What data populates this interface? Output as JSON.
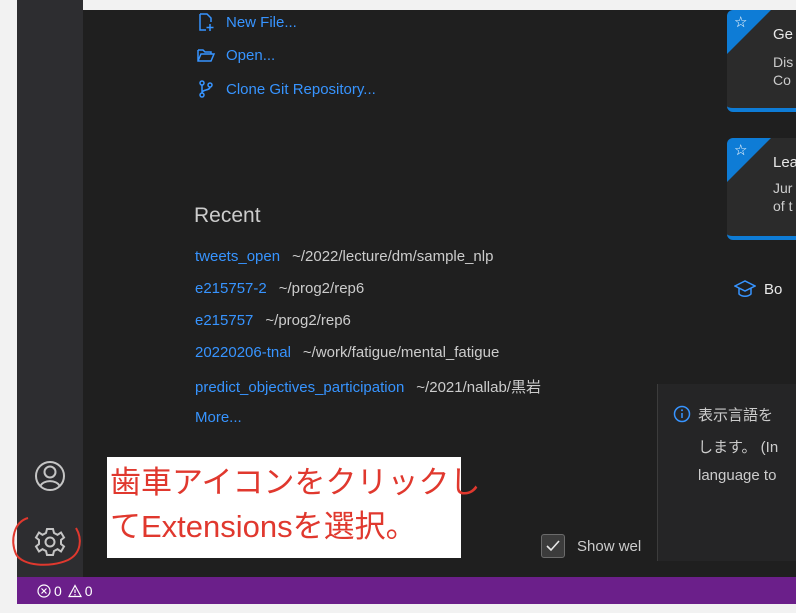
{
  "start": {
    "items": [
      {
        "label": "New File...",
        "icon": "new-file-icon"
      },
      {
        "label": "Open...",
        "icon": "folder-open-icon"
      },
      {
        "label": "Clone Git Repository...",
        "icon": "source-control-icon"
      }
    ]
  },
  "recent": {
    "title": "Recent",
    "items": [
      {
        "name": "tweets_open",
        "path": "~/2022/lecture/dm/sample_nlp"
      },
      {
        "name": "e215757-2",
        "path": "~/prog2/rep6"
      },
      {
        "name": "e215757",
        "path": "~/prog2/rep6"
      },
      {
        "name": "20220206-tnal",
        "path": "~/work/fatigue/mental_fatigue"
      },
      {
        "name": "predict_objectives_participation",
        "path": "~/2021/nallab/黒岩"
      }
    ],
    "more": "More..."
  },
  "walkthroughs": [
    {
      "title": "Ge",
      "desc1": "Dis",
      "desc2": "Co"
    },
    {
      "title": "Lea",
      "desc1": "Jur",
      "desc2": "of t"
    }
  ],
  "book_label": "Bo",
  "notification": {
    "line1": "表示言語を",
    "line2": "します。 (In",
    "line3": "language to"
  },
  "annotation": {
    "line1": "歯車アイコンをクリックし",
    "line2": "てExtensionsを選択。"
  },
  "show_welcome": {
    "label": "Show wel",
    "checked": true
  },
  "status": {
    "errors": "0",
    "warnings": "0"
  },
  "colors": {
    "accent": "#3794ff",
    "statusbar": "#6b1f8a",
    "annotation": "#e0382e",
    "card_border": "#0e7cd6"
  }
}
